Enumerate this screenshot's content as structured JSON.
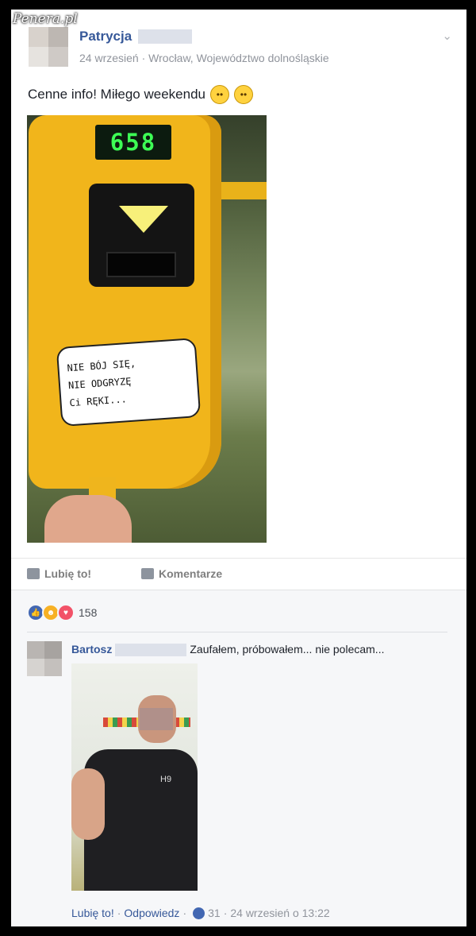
{
  "watermark": "Penera.pl",
  "post": {
    "author": "Patrycja",
    "date": "24 wrzesień",
    "location": "Wrocław, Województwo dolnośląskie",
    "text": "Cenne info! Miłego weekendu",
    "photo": {
      "display_number": "658",
      "sticker_lines": [
        "NIE BÓJ SIĘ,",
        "NIE ODGRYZĘ",
        "Ci RĘKI..."
      ]
    },
    "actions": {
      "like": "Lubię to!",
      "comment": "Komentarze"
    },
    "reactions_count": "158"
  },
  "comment": {
    "author": "Bartosz",
    "text": "Zaufałem, próbowałem... nie polecam...",
    "photo_shirt_text": "H9",
    "footer": {
      "like": "Lubię to!",
      "reply": "Odpowiedz",
      "likes": "31",
      "timestamp": "24 wrzesień o 13:22"
    }
  },
  "colors": {
    "link": "#365899",
    "accent": "#4267b2",
    "meta": "#90949c"
  }
}
